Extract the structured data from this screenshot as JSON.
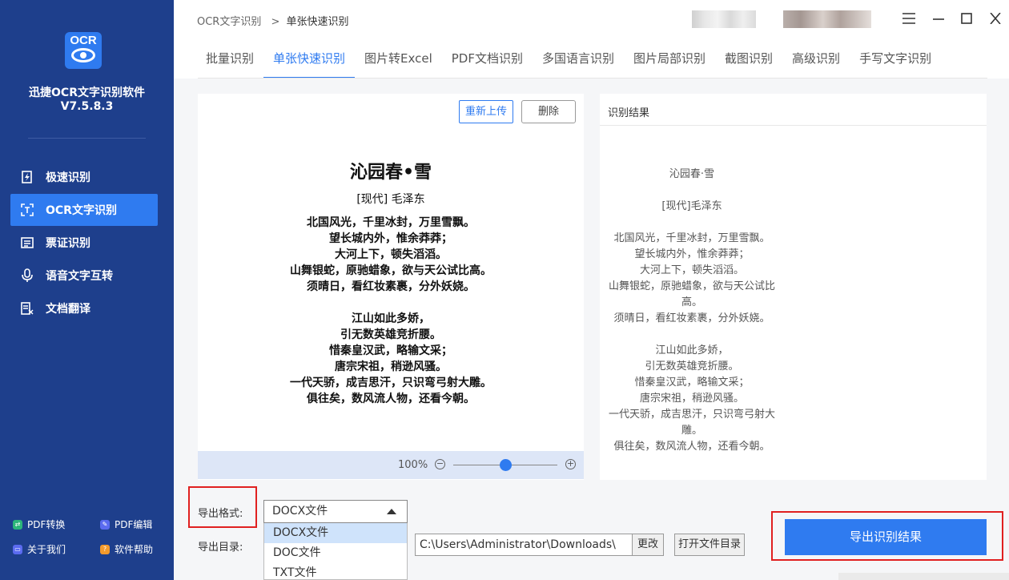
{
  "sidebar": {
    "logo_text": "OCR",
    "app_name": "迅捷OCR文字识别软件",
    "version": "V7.5.8.3",
    "items": [
      {
        "label": "极速识别",
        "icon": "lightning-doc-icon"
      },
      {
        "label": "OCR文字识别",
        "icon": "scan-frame-icon",
        "active": true
      },
      {
        "label": "票证识别",
        "icon": "ticket-icon"
      },
      {
        "label": "语音文字互转",
        "icon": "microphone-icon"
      },
      {
        "label": "文档翻译",
        "icon": "translate-doc-icon"
      }
    ],
    "bottom_links": [
      {
        "label": "PDF转换",
        "icon": "pdf-convert-icon",
        "color": "#2cb57a"
      },
      {
        "label": "PDF编辑",
        "icon": "pdf-edit-icon",
        "color": "#5b6bf0"
      },
      {
        "label": "关于我们",
        "icon": "about-icon",
        "color": "#5b6bf0"
      },
      {
        "label": "软件帮助",
        "icon": "help-icon",
        "color": "#f39a2c"
      }
    ]
  },
  "header": {
    "breadcrumb_root": "OCR文字识别",
    "breadcrumb_sep": ">",
    "breadcrumb_current": "单张快速识别"
  },
  "tabs": [
    "批量识别",
    "单张快速识别",
    "图片转Excel",
    "PDF文档识别",
    "多国语言识别",
    "图片局部识别",
    "截图识别",
    "高级识别",
    "手写文字识别"
  ],
  "active_tab": "单张快速识别",
  "image_panel": {
    "reupload_label": "重新上传",
    "delete_label": "删除",
    "title": "沁园春•雪",
    "author": "[现代] 毛泽东",
    "stanza1": [
      "北国风光，千里冰封，万里雪飘。",
      "望长城内外，惟余莽莽；",
      "大河上下，顿失滔滔。",
      "山舞银蛇，原驰蜡象，欲与天公试比高。",
      "须晴日，看红妆素裹，分外妖娆。"
    ],
    "stanza2": [
      "江山如此多娇，",
      "引无数英雄竞折腰。",
      "惜秦皇汉武，略输文采；",
      "唐宗宋祖，稍逊风骚。",
      "一代天骄，成吉思汗，只识弯弓射大雕。",
      "俱往矣，数风流人物，还看今朝。"
    ],
    "zoom_label": "100%",
    "zoom_value": 0.5
  },
  "result_panel": {
    "header": "识别结果",
    "title": "沁园春·雪",
    "author": "[现代]毛泽东",
    "stanza1": [
      "北国风光，千里冰封，万里雪飘。",
      "望长城内外，惟余莽莽；",
      "大河上下，顿失滔滔。",
      "山舞银蛇，原驰蜡象，欲与天公试比高。",
      "须晴日，看红妆素裹，分外妖娆。"
    ],
    "stanza2": [
      "江山如此多娇，",
      "引无数英雄竞折腰。",
      "惜秦皇汉武，略输文采；",
      "唐宗宋祖，稍逊风骚。",
      "一代天骄，成吉思汗，只识弯弓射大雕。",
      "俱往矣，数风流人物，还看今朝。"
    ]
  },
  "export": {
    "format_label": "导出格式:",
    "format_selected": "DOCX文件",
    "format_options": [
      "DOCX文件",
      "DOC文件",
      "TXT文件"
    ],
    "dir_label": "导出目录:",
    "dir_path": "C:\\Users\\Administrator\\Downloads\\",
    "change_label": "更改",
    "open_dir_label": "打开文件目录",
    "export_button": "导出识别结果"
  },
  "colors": {
    "sidebar_bg": "#1e3f8c",
    "accent": "#2f7bf0",
    "highlight_red": "#e02020"
  }
}
